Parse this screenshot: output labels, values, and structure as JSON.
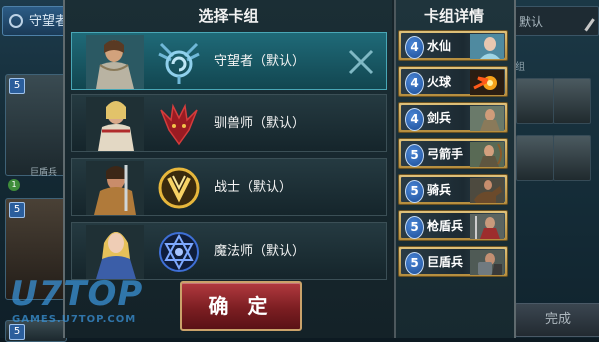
{
  "background": {
    "top_left_tab": "守望者",
    "search_value": "默认",
    "right_tag": "组",
    "left_card_badges": [
      "5",
      "5",
      "5"
    ],
    "left_card_label": "巨盾兵",
    "left_card_level": "1",
    "done_button": "完成",
    "watermark_big": "U7TOP",
    "watermark_small": "GAMES.U7TOP.COM"
  },
  "modal": {
    "left_title": "选择卡组",
    "right_title": "卡组详情",
    "decks": [
      {
        "name": "守望者（默认）",
        "emblem": "watcher-emblem",
        "selected": true
      },
      {
        "name": "驯兽师（默认）",
        "emblem": "beastmaster-emblem",
        "selected": false
      },
      {
        "name": "战士（默认）",
        "emblem": "warrior-emblem",
        "selected": false
      },
      {
        "name": "魔法师（默认）",
        "emblem": "mage-emblem",
        "selected": false
      }
    ],
    "confirm_label": "确 定",
    "cards": [
      {
        "cost": "4",
        "name": "水仙"
      },
      {
        "cost": "4",
        "name": "火球"
      },
      {
        "cost": "4",
        "name": "剑兵"
      },
      {
        "cost": "5",
        "name": "弓箭手"
      },
      {
        "cost": "5",
        "name": "骑兵"
      },
      {
        "cost": "5",
        "name": "枪盾兵"
      },
      {
        "cost": "5",
        "name": "巨盾兵"
      }
    ]
  },
  "colors": {
    "selected_row": "#1f6a78",
    "confirm_button": "#9a2a30",
    "card_border": "#c9a85a",
    "cost_badge": "#2b63b8"
  }
}
